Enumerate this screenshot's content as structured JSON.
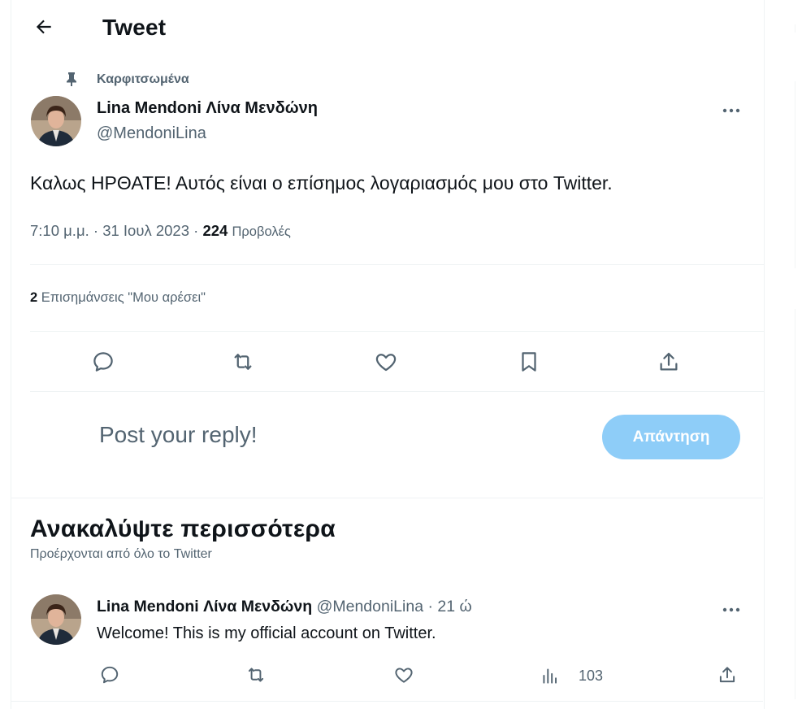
{
  "header": {
    "title": "Tweet",
    "back_icon": "arrow-left-icon"
  },
  "pinned": {
    "label": "Καρφιτσωμένα",
    "icon": "pin-icon"
  },
  "tweet": {
    "author_name": "Lina Mendoni Λίνα Μενδώνη",
    "author_handle": "@MendoniLina",
    "text": "Καλως ΗΡΘΑΤΕ! Αυτός είναι ο επίσημος λογαριασμός μου στο Twitter.",
    "time": "7:10 μ.μ.",
    "date": "31 Ιουλ 2023",
    "views_count": "224",
    "views_label": "Προβολές",
    "likes_count": "2",
    "likes_label": "Επισημάνσεις \"Μου αρέσει\""
  },
  "actions": [
    "reply-icon",
    "retweet-icon",
    "like-icon",
    "bookmark-icon",
    "share-icon"
  ],
  "reply_box": {
    "placeholder": "Post your reply!",
    "button_label": "Απάντηση"
  },
  "discover": {
    "title": "Ανακαλύψτε περισσότερα",
    "subtitle": "Προέρχονται από όλο το Twitter",
    "tweets": [
      {
        "author_name": "Lina Mendoni Λίνα Μενδώνη",
        "author_handle": "@MendoniLina",
        "separator": "·",
        "time_ago": "21 ώ",
        "text": "Welcome! This is my official account on Twitter.",
        "views": "103"
      }
    ]
  },
  "colors": {
    "accent": "#1d9bf0",
    "reply_button": "#8ecdf8",
    "muted_text": "#536471",
    "divider": "#eff3f4"
  }
}
